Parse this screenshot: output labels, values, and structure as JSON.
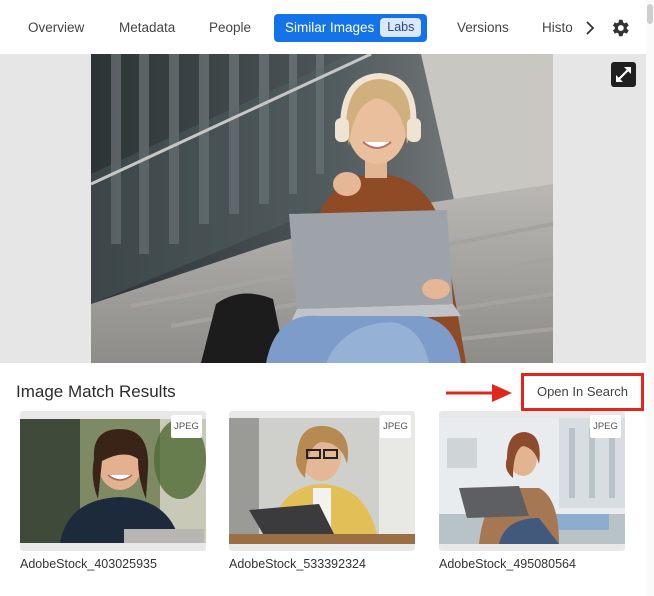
{
  "tabs": [
    {
      "label": "Overview"
    },
    {
      "label": "Metadata"
    },
    {
      "label": "People"
    },
    {
      "label": "Similar Images",
      "badge": "Labs",
      "active": true
    },
    {
      "label": "Versions"
    },
    {
      "label": "Histo"
    }
  ],
  "icons": {
    "next": "chevron-right-icon",
    "settings": "gear-icon",
    "expand": "expand-icon",
    "arrow": "arrow-right-icon"
  },
  "colors": {
    "accent": "#1473e6",
    "badge_bg": "#dbe7fb",
    "highlight": "#e0261d"
  },
  "results": {
    "title": "Image Match Results",
    "open_label": "Open In Search",
    "items": [
      {
        "name": "AdobeStock_403025935",
        "format": "JPEG"
      },
      {
        "name": "AdobeStock_533392324",
        "format": "JPEG"
      },
      {
        "name": "AdobeStock_495080564",
        "format": "JPEG"
      }
    ]
  }
}
